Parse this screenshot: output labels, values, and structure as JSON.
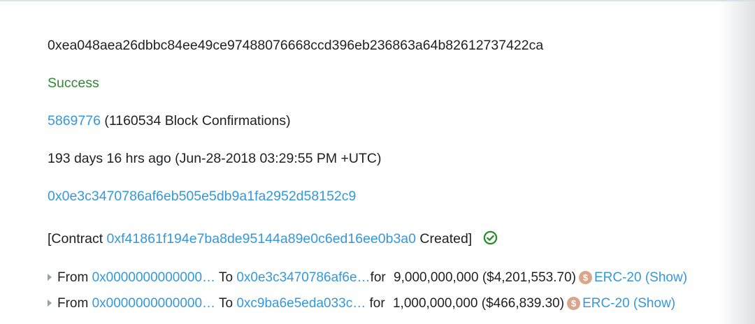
{
  "txn": {
    "hash": "0xea048aea26dbbc84ee49ce97488076668ccd396eb236863a64b82612737422ca",
    "status": "Success",
    "block_number": "5869776",
    "block_confirmations": "(1160534 Block Confirmations)",
    "timestamp": "193 days 16 hrs ago (Jun-28-2018 03:29:55 PM +UTC)",
    "from_address": "0x0e3c3470786af6eb505e5db9a1fa2952d58152c9",
    "to_prefix": "[Contract",
    "contract_address": "0xf41861f194e7ba8de95144a89e0c6ed16ee0b3a0",
    "to_suffix": "Created]"
  },
  "colors": {
    "link": "#3498db",
    "success": "#2f8a2f",
    "check_icon": "#2f8a2f",
    "coin_icon": "#d9a68b"
  },
  "token_transfers": [
    {
      "from_label": "From",
      "from": "0x0000000000000…",
      "to_label": "To",
      "to": "0x0e3c3470786af6e…",
      "for_label": "for",
      "amount": "9,000,000,000 ($4,201,553.70)",
      "token_icon": "coin-icon",
      "token": "ERC-20 (Show)"
    },
    {
      "from_label": "From",
      "from": "0x0000000000000…",
      "to_label": "To",
      "to": "0xc9ba6e5eda033c…",
      "for_label": "for",
      "amount": "1,000,000,000 ($466,839.30)",
      "token_icon": "coin-icon",
      "token": "ERC-20 (Show)"
    }
  ]
}
